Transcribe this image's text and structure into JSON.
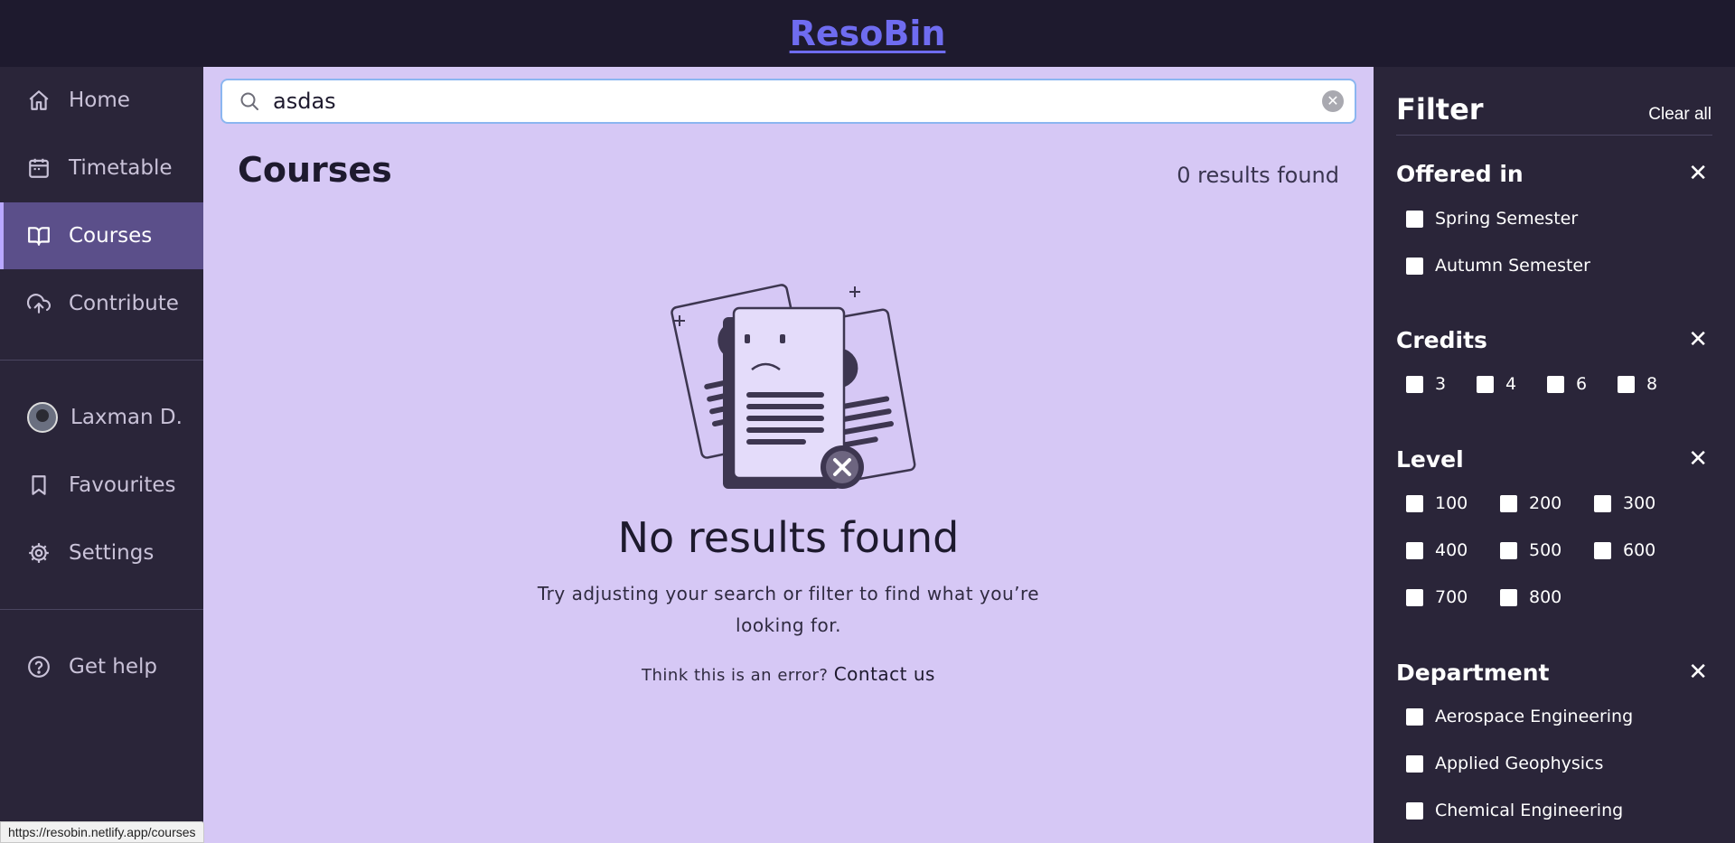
{
  "app": {
    "brand": "ResoBin"
  },
  "sidebar": {
    "items": [
      {
        "label": "Home",
        "icon": "home-icon"
      },
      {
        "label": "Timetable",
        "icon": "calendar-icon"
      },
      {
        "label": "Courses",
        "icon": "book-icon",
        "active": true
      },
      {
        "label": "Contribute",
        "icon": "upload-cloud-icon"
      },
      {
        "label": "Laxman D.",
        "icon": "avatar"
      },
      {
        "label": "Favourites",
        "icon": "bookmark-icon"
      },
      {
        "label": "Settings",
        "icon": "gear-icon"
      },
      {
        "label": "Get help",
        "icon": "help-icon"
      }
    ]
  },
  "search": {
    "value": "asdas"
  },
  "main": {
    "title": "Courses",
    "results": "0 results found",
    "empty_title": "No results found",
    "empty_desc": "Try adjusting your search or filter to find what you’re looking for.",
    "error_prompt": "Think this is an error?",
    "contact_label": "Contact us"
  },
  "filter": {
    "title": "Filter",
    "clear_all": "Clear all",
    "offered_in": {
      "title": "Offered in",
      "options": [
        "Spring Semester",
        "Autumn Semester"
      ]
    },
    "credits": {
      "title": "Credits",
      "options": [
        "3",
        "4",
        "6",
        "8"
      ]
    },
    "level": {
      "title": "Level",
      "options": [
        "100",
        "200",
        "300",
        "400",
        "500",
        "600",
        "700",
        "800"
      ]
    },
    "department": {
      "title": "Department",
      "options": [
        "Aerospace Engineering",
        "Applied Geophysics",
        "Chemical Engineering"
      ]
    }
  },
  "status_url": "https://resobin.netlify.app/courses",
  "colors": {
    "accent": "#6f6cf0",
    "sidebar_bg": "#2a2539",
    "topbar_bg": "#1e1a2e",
    "main_bg": "#d6c8f5",
    "active_item": "#5b4f8a"
  }
}
